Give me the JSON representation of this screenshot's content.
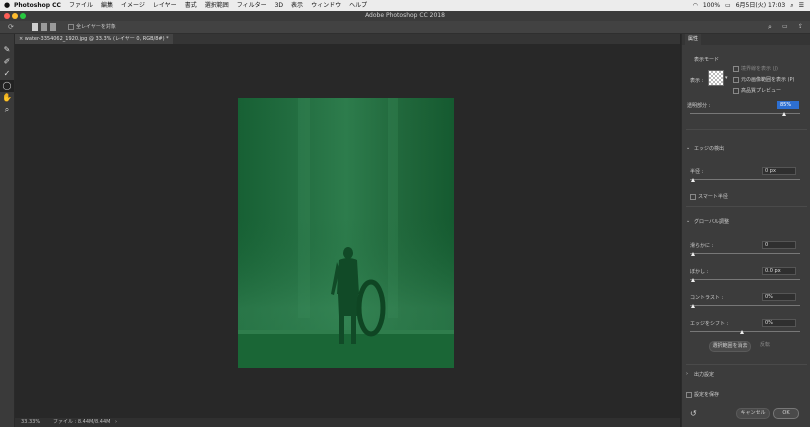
{
  "menubar": {
    "apple": "",
    "app": "Photoshop CC",
    "items": [
      "ファイル",
      "編集",
      "イメージ",
      "レイヤー",
      "書式",
      "選択範囲",
      "フィルター",
      "3D",
      "表示",
      "ウィンドウ",
      "ヘルプ"
    ],
    "status": "100%",
    "clock": "6月5日(火) 17:03"
  },
  "window": {
    "title": "Adobe Photoshop CC 2018"
  },
  "options": {
    "all_layers_label": "全レイヤーを対象"
  },
  "document": {
    "tab_label": "water-3354062_1920.jpg @ 33.3% (レイヤー 0, RGB/8#) *"
  },
  "status": {
    "zoom": "33.33%",
    "file_info": "ファイル : 8.44M/8.44M"
  },
  "panel": {
    "tab": "属性",
    "view_mode": {
      "title": "表示モード",
      "view_label": "表示 :",
      "options": [
        "境界線を表示 (J)",
        "元の画像範囲を表示 (P)",
        "高品質プレビュー"
      ]
    },
    "opacity": {
      "label": "透明部分 :",
      "value": "85%",
      "fraction": 0.85
    },
    "edge": {
      "title": "エッジの検出",
      "radius_label": "半径 :",
      "radius_value": "0 px",
      "smart_radius_label": "スマート半径"
    },
    "global": {
      "title": "グローバル調整",
      "smooth_label": "滑らかに :",
      "smooth_value": "0",
      "feather_label": "ぼかし :",
      "feather_value": "0.0 px",
      "contrast_label": "コントラスト :",
      "contrast_value": "0%",
      "shift_label": "エッジをシフト :",
      "shift_value": "0%",
      "clear_button": "選択範囲を消去",
      "invert_button": "反転"
    },
    "output": {
      "title": "出力設定",
      "remember_label": "設定を保存"
    },
    "cancel_button": "キャンセル",
    "ok_button": "OK"
  },
  "colors": {
    "mask": "#1a6a3a",
    "accent": "#2d6fd1"
  }
}
